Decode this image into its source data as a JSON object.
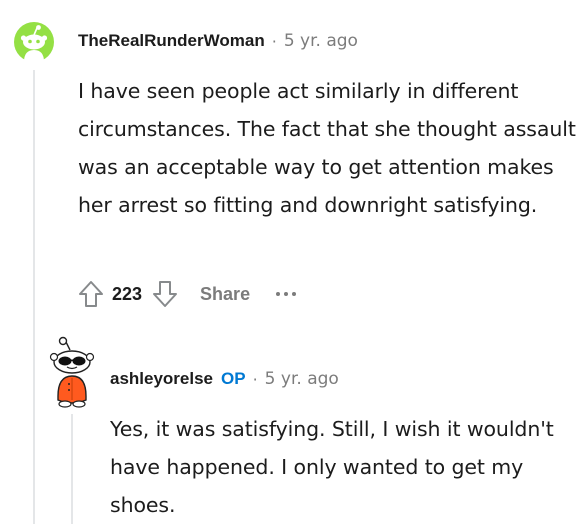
{
  "comments": [
    {
      "username": "TheRealRunderWoman",
      "separator": "·",
      "time": "5 yr. ago",
      "body": "I have seen people act similarly in different circumstances. The fact that she thought assault was an acceptable way to get attention makes her arrest so fitting and downright satisfying.",
      "score": "223",
      "share_label": "Share",
      "avatar_icon": "snoo-avatar-icon",
      "avatar_bg": "#94e044"
    },
    {
      "username": "ashleyorelse",
      "op_badge": "OP",
      "separator": "·",
      "time": "5 yr. ago",
      "body": "Yes, it was satisfying. Still, I wish it wouldn't have happened. I only wanted to get my shoes.",
      "avatar_icon": "snoo-sunglasses-avatar-icon"
    }
  ],
  "colors": {
    "text": "#1c1c1c",
    "meta": "#7c7c7c",
    "op": "#0079d3",
    "thread_line": "#e4e6e8"
  }
}
